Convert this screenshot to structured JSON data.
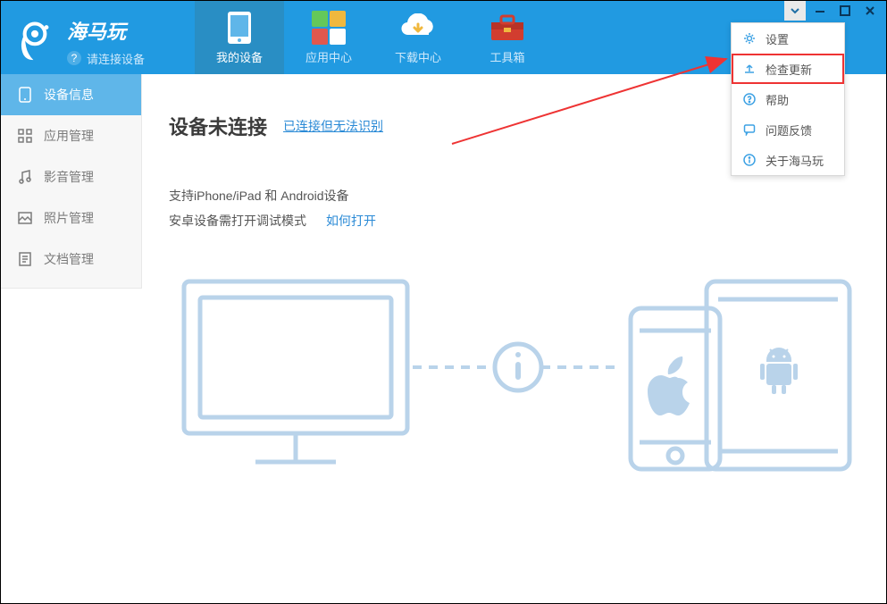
{
  "header": {
    "brand": "海马玩",
    "connect_hint": "请连接设备",
    "nav": [
      {
        "label": "我的设备"
      },
      {
        "label": "应用中心"
      },
      {
        "label": "下载中心"
      },
      {
        "label": "工具箱"
      }
    ]
  },
  "sidebar": {
    "items": [
      {
        "label": "设备信息"
      },
      {
        "label": "应用管理"
      },
      {
        "label": "影音管理"
      },
      {
        "label": "照片管理"
      },
      {
        "label": "文档管理"
      }
    ]
  },
  "main": {
    "title": "设备未连接",
    "link_unrecognized": "已连接但无法识别",
    "support_line": "支持iPhone/iPad 和 Android设备",
    "android_line": "安卓设备需打开调试模式",
    "how_link": "如何打开"
  },
  "menu": {
    "items": [
      {
        "label": "设置",
        "icon": "gear"
      },
      {
        "label": "检查更新",
        "icon": "upload",
        "highlight": true
      },
      {
        "label": "帮助",
        "icon": "help"
      },
      {
        "label": "问题反馈",
        "icon": "chat"
      },
      {
        "label": "关于海马玩",
        "icon": "info"
      }
    ]
  }
}
